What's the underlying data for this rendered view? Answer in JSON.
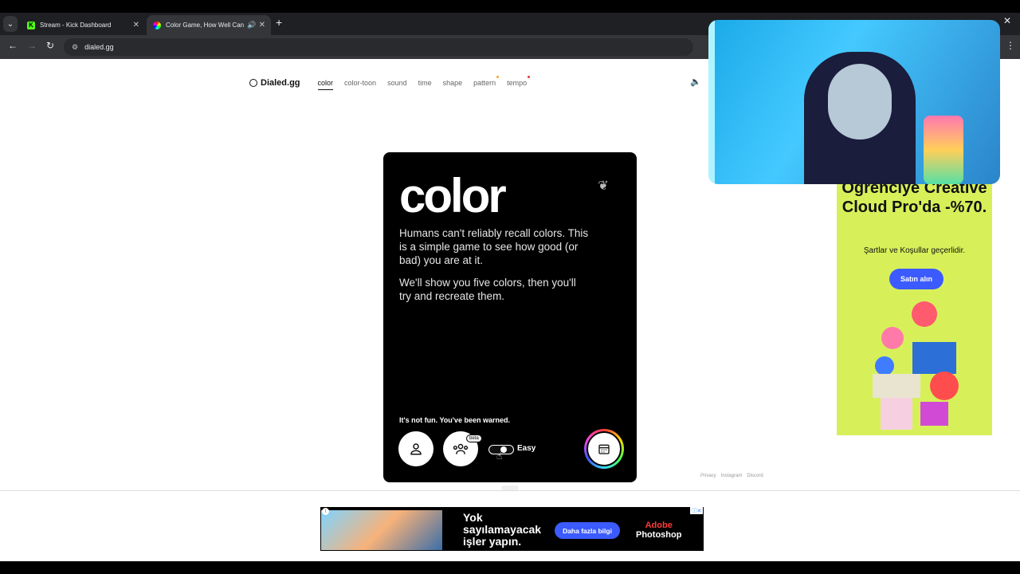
{
  "browser": {
    "tabs": [
      {
        "title": "Stream - Kick Dashboard",
        "icon": "kick-icon",
        "active": false
      },
      {
        "title": "Color Game, How Well Can",
        "icon": "color-wheel-icon",
        "active": true,
        "audio": true
      }
    ],
    "url": "dialed.gg"
  },
  "site": {
    "logo": "Dialed.gg",
    "nav": [
      "color",
      "color-toon",
      "sound",
      "time",
      "shape",
      "pattern",
      "tempo"
    ],
    "active": "color",
    "nav_dot_colors": {
      "pattern": "#f5a623",
      "tempo": "#e23b3b"
    }
  },
  "card": {
    "title": "color",
    "p1": "Humans can't reliably recall colors. This is a simple game to see how good (or bad) you are at it.",
    "p2": "We'll show you five colors, then you'll try and recreate them.",
    "warning": "It's not fun. You've been warned.",
    "beta": "beta",
    "mode": "Easy"
  },
  "footer": [
    "Privacy",
    "Instagram",
    "Discord"
  ],
  "side_ad": {
    "headline": "Öğrenciye Creative Cloud Pro'da -%70.",
    "terms": "Şartlar ve Koşullar geçerlidir.",
    "cta": "Satın alın"
  },
  "bottom_ad": {
    "message": "Yok sayılamayacak işler yapın.",
    "cta": "Daha fazla bilgi",
    "brand_top": "Adobe",
    "brand_bottom": "Photoshop"
  }
}
